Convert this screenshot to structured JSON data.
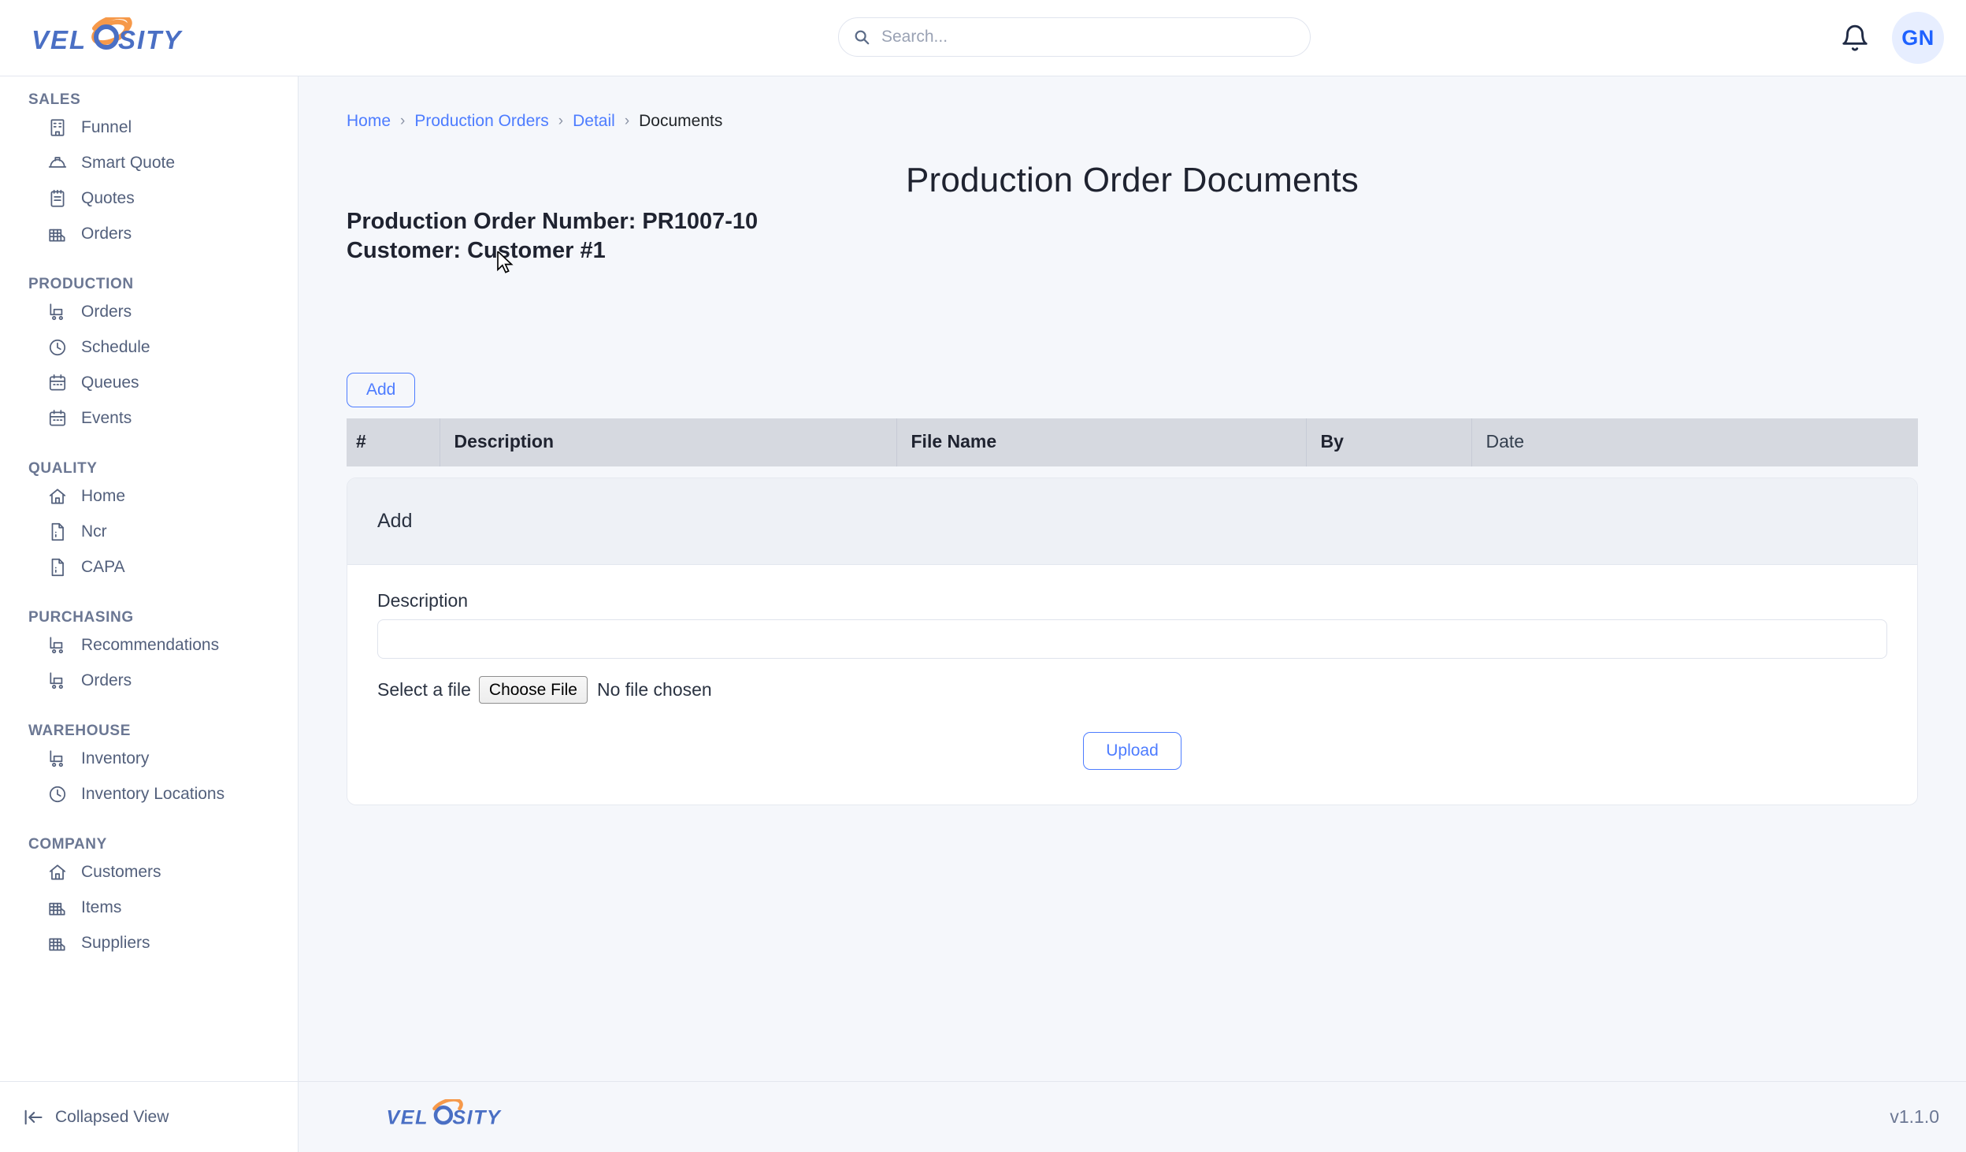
{
  "brand": {
    "name": "VELOSITY",
    "text_color": "#4a6fc4",
    "accent_color": "#f6994a"
  },
  "topbar": {
    "search": {
      "placeholder": "Search...",
      "value": "",
      "icon": "search-icon"
    },
    "notifications_icon": "bell-icon",
    "avatar_initials": "GN"
  },
  "sidebar": {
    "groups": [
      {
        "title": "SALES",
        "items": [
          {
            "label": "Funnel",
            "icon": "building-icon"
          },
          {
            "label": "Smart Quote",
            "icon": "hard-hat-icon"
          },
          {
            "label": "Quotes",
            "icon": "clipboard-icon"
          },
          {
            "label": "Orders",
            "icon": "factory-icon"
          }
        ]
      },
      {
        "title": "PRODUCTION",
        "items": [
          {
            "label": "Orders",
            "icon": "trolley-icon"
          },
          {
            "label": "Schedule",
            "icon": "clock-icon"
          },
          {
            "label": "Queues",
            "icon": "calendar-icon"
          },
          {
            "label": "Events",
            "icon": "calendar-icon"
          }
        ]
      },
      {
        "title": "QUALITY",
        "items": [
          {
            "label": "Home",
            "icon": "home-icon"
          },
          {
            "label": "Ncr",
            "icon": "file-text-icon"
          },
          {
            "label": "CAPA",
            "icon": "file-text-icon"
          }
        ]
      },
      {
        "title": "PURCHASING",
        "items": [
          {
            "label": "Recommendations",
            "icon": "trolley-icon"
          },
          {
            "label": "Orders",
            "icon": "trolley-icon"
          }
        ]
      },
      {
        "title": "WAREHOUSE",
        "items": [
          {
            "label": "Inventory",
            "icon": "trolley-icon"
          },
          {
            "label": "Inventory Locations",
            "icon": "clock-icon"
          }
        ]
      },
      {
        "title": "COMPANY",
        "items": [
          {
            "label": "Customers",
            "icon": "home-icon"
          },
          {
            "label": "Items",
            "icon": "factory-icon"
          },
          {
            "label": "Suppliers",
            "icon": "factory-icon"
          }
        ]
      }
    ],
    "collapse": {
      "label": "Collapsed View",
      "icon": "collapse-left-icon"
    }
  },
  "main": {
    "breadcrumb": [
      {
        "label": "Home",
        "link": true
      },
      {
        "label": "Production Orders",
        "link": true
      },
      {
        "label": "Detail",
        "link": true
      },
      {
        "label": "Documents",
        "link": false
      }
    ],
    "breadcrumb_separator": "›",
    "title": "Production Order Documents",
    "order_line": "Production Order Number: PR1007-10",
    "customer_line": "Customer: Customer #1",
    "add_button_label": "Add",
    "table": {
      "columns": [
        "#",
        "Description",
        "File Name",
        "By",
        "Date"
      ],
      "rows": []
    },
    "add_card": {
      "header": "Add",
      "description_label": "Description",
      "description_value": "",
      "select_file_label": "Select a file",
      "choose_file_button": "Choose File",
      "file_status": "No file chosen",
      "upload_button_label": "Upload"
    }
  },
  "footer": {
    "version": "v1.1.0"
  },
  "colors": {
    "accent_blue": "#4d7cff",
    "link_blue": "#4d7cff",
    "page_bg": "#f5f7fb",
    "table_header_bg": "#d6d9e0",
    "card_header_bg": "#eef1f6",
    "sidebar_text": "#53607c"
  }
}
